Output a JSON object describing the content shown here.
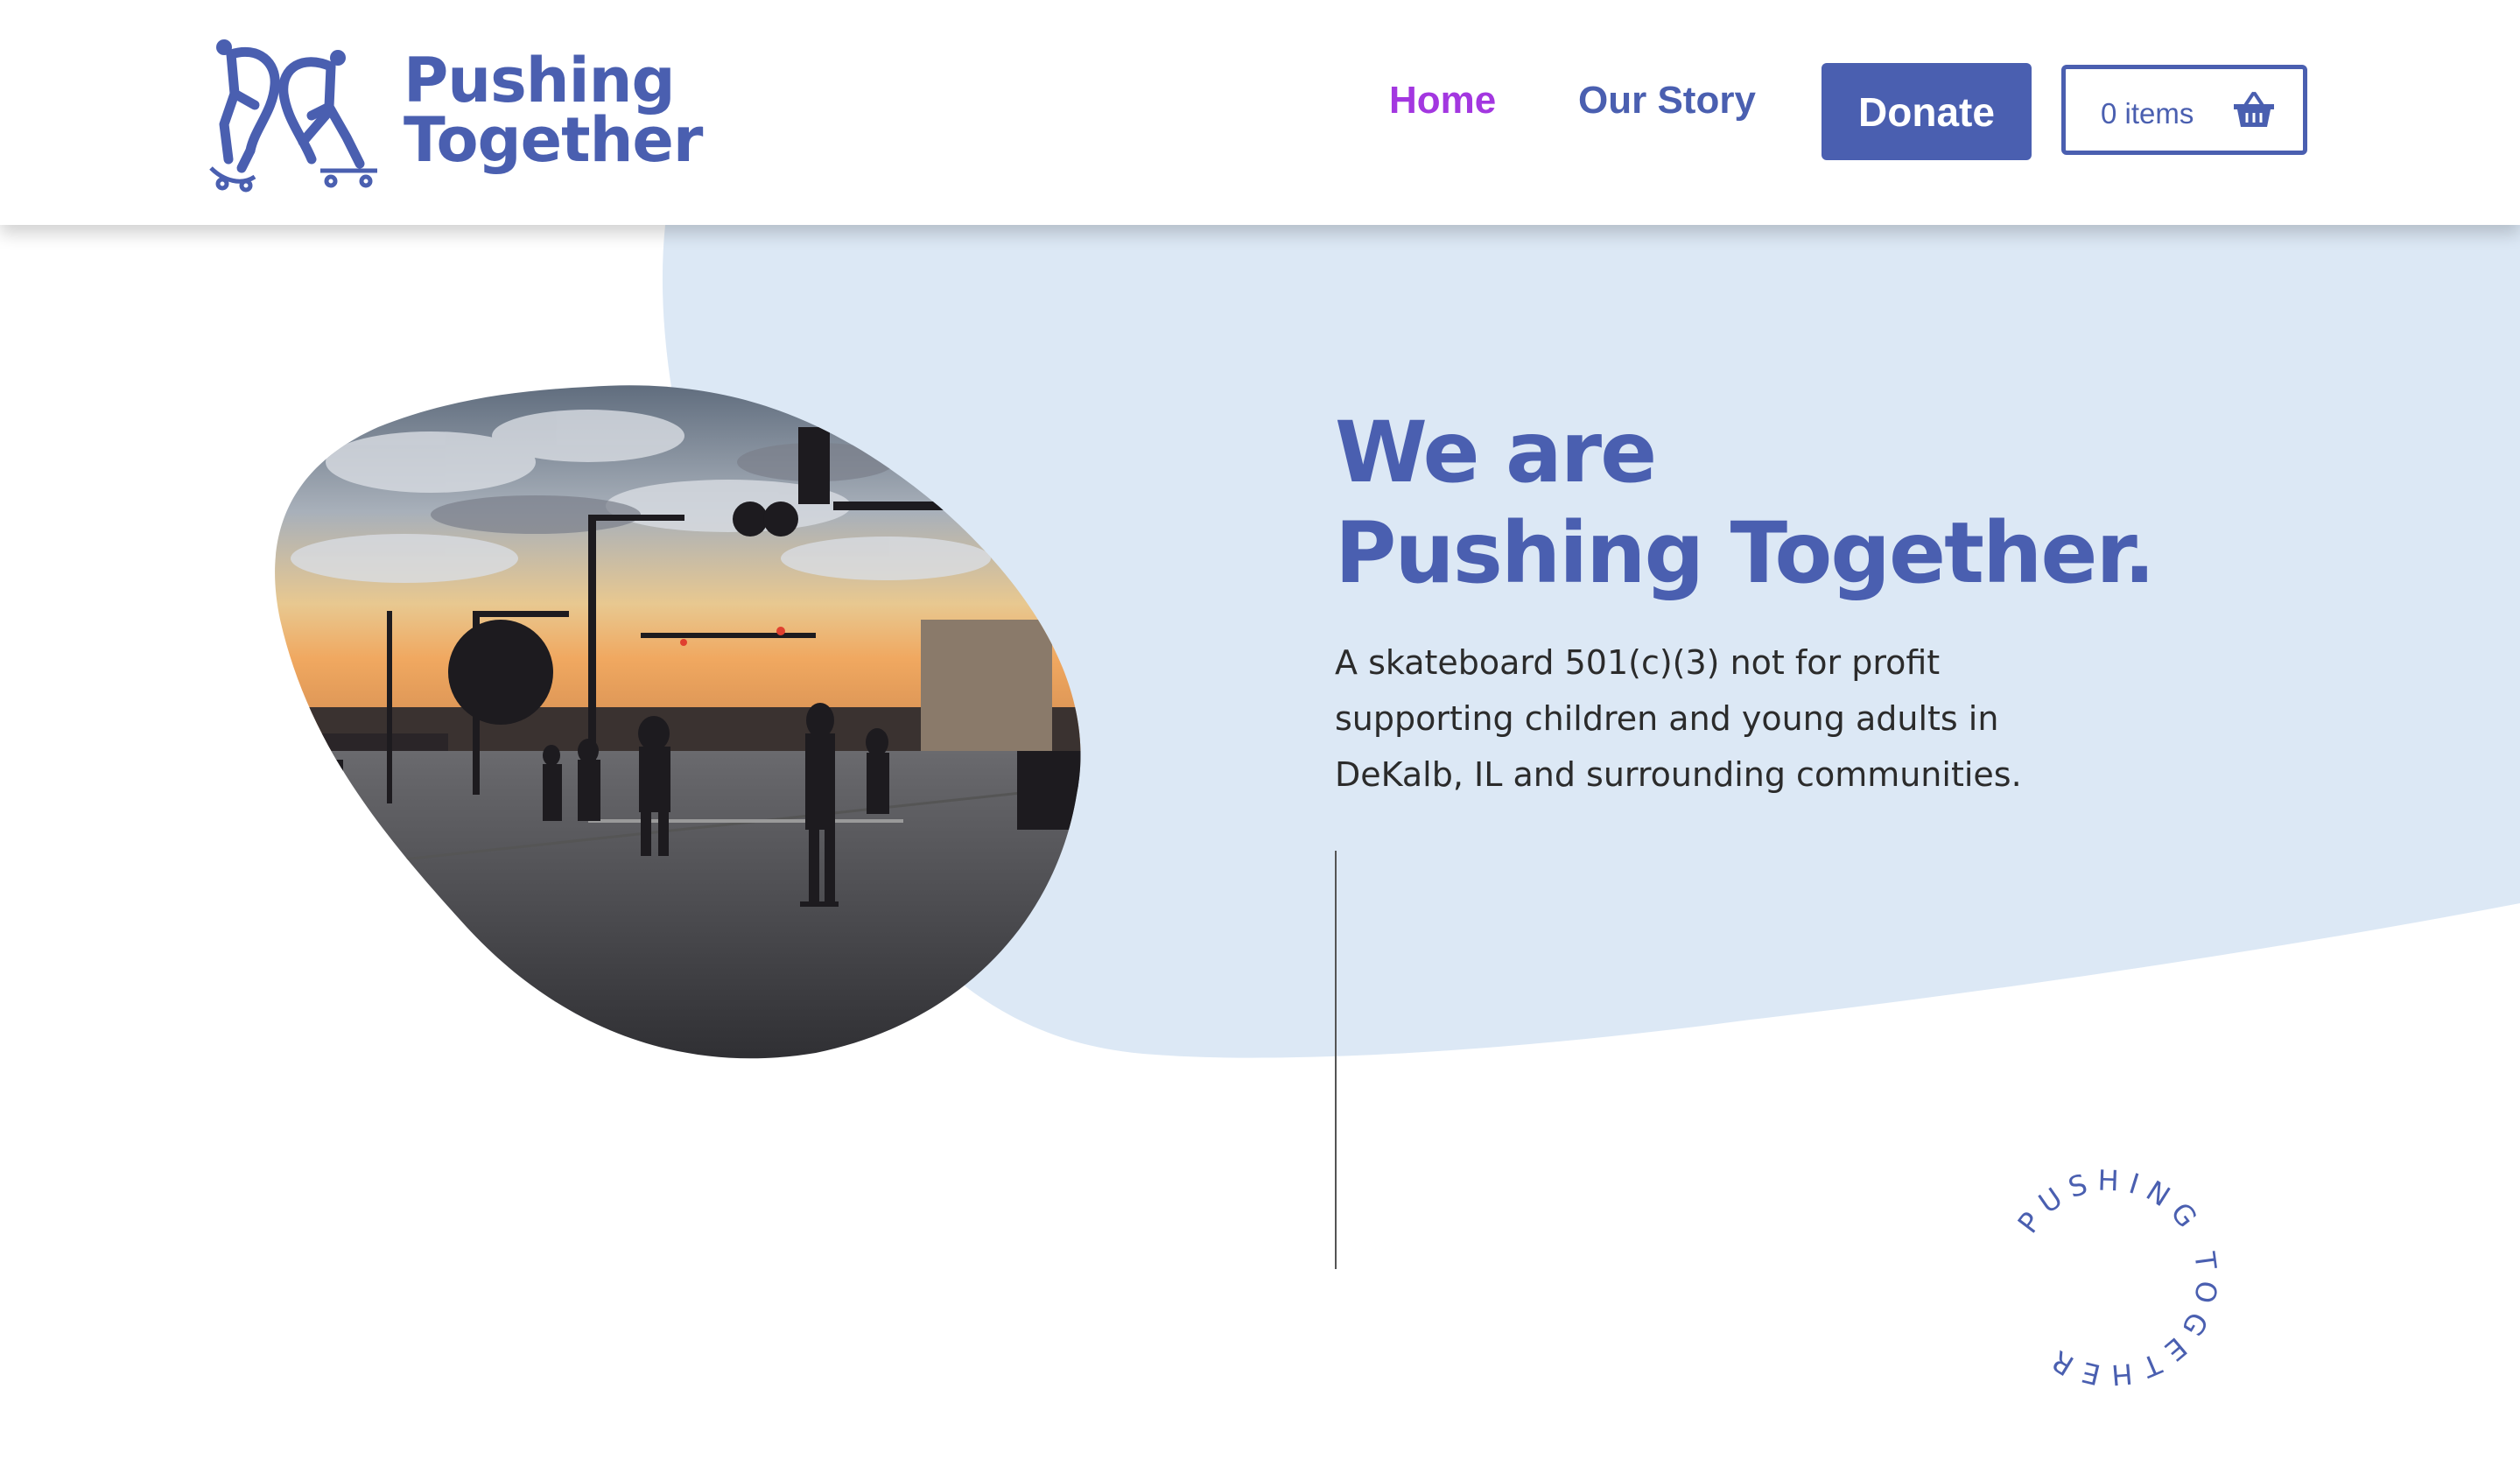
{
  "colors": {
    "brand": "#4a5fb0",
    "accent": "#a337e0",
    "hero_bg": "#dce8f5",
    "text": "#2b2b2b"
  },
  "logo": {
    "line1": "Pushing",
    "line2": "Together",
    "icon": "skateboarders-heart-icon"
  },
  "nav": {
    "home": "Home",
    "our_story": "Our Story",
    "donate": "Donate",
    "cart_label": "0 items",
    "cart_icon": "basket-icon"
  },
  "hero": {
    "title_line1": "We are",
    "title_line2": "Pushing Together.",
    "body_line1": "A skateboard 501(c)(3) not for profit",
    "body_line2": "supporting children and young adults in",
    "body_line3": "DeKalb, IL and surrounding communities.",
    "photo": "skateboarders-street-sunset-photo",
    "circular_text": "PUSHING TOGETHER"
  }
}
